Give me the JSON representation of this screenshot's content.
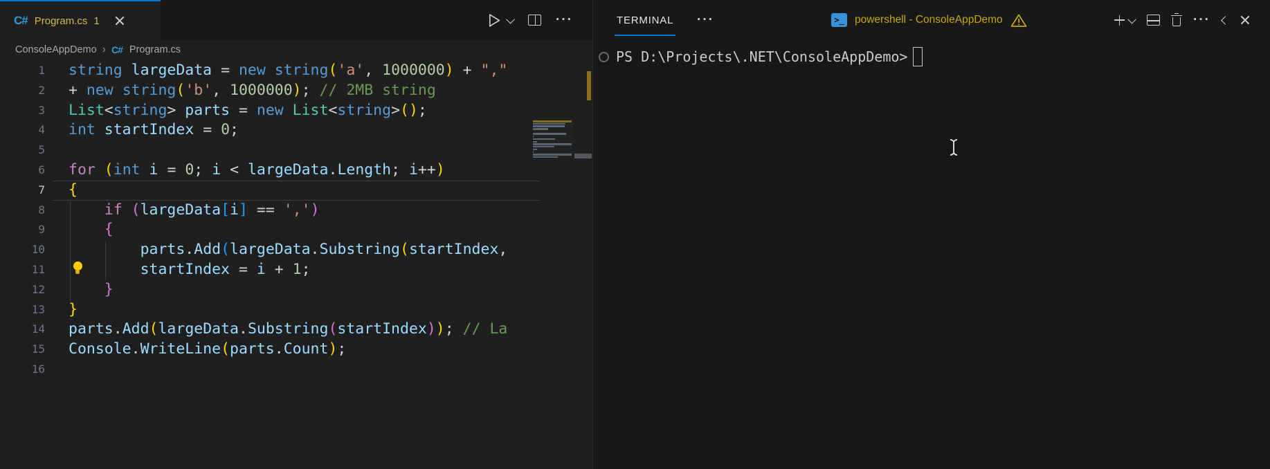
{
  "colors": {
    "accent": "#0078D4",
    "tab_modified_label": "#D7BA4D",
    "terminal_warning_label": "#CCA700",
    "editor_background": "#1F1F1F",
    "panel_background": "#181818"
  },
  "editor": {
    "tab": {
      "icon": "csharp-icon",
      "csharp_glyph": "C#",
      "label": "Program.cs",
      "badge": "1"
    },
    "actions": {
      "more_glyph": "···"
    },
    "breadcrumb": {
      "folder": "ConsoleAppDemo",
      "separator": "›",
      "csharp_glyph": "C#",
      "file": "Program.cs"
    },
    "token_colors": {
      "kw": "#569CD6",
      "ctrl": "#C586C0",
      "var": "#9CDCFE",
      "ty": "#4EC9B0",
      "num": "#B5CEA8",
      "str": "#CE9178",
      "com": "#6A9955",
      "pl": "#D4D4D4",
      "b1": "#FFD700",
      "b2": "#DA70D6",
      "b3": "#179FFF"
    },
    "lines": [
      {
        "n": "1",
        "t": [
          [
            "kw",
            "string"
          ],
          [
            "pl",
            " "
          ],
          [
            "var",
            "largeData"
          ],
          [
            "pl",
            " = "
          ],
          [
            "kw",
            "new"
          ],
          [
            "pl",
            " "
          ],
          [
            "kw",
            "string"
          ],
          [
            "b1",
            "("
          ],
          [
            "str",
            "'a'"
          ],
          [
            "pl",
            ", "
          ],
          [
            "num",
            "1000000"
          ],
          [
            "b1",
            ")"
          ],
          [
            "pl",
            " + "
          ],
          [
            "str",
            "\",\""
          ]
        ]
      },
      {
        "n": "2",
        "t": [
          [
            "pl",
            "+ "
          ],
          [
            "kw",
            "new"
          ],
          [
            "pl",
            " "
          ],
          [
            "kw",
            "string"
          ],
          [
            "b1",
            "("
          ],
          [
            "str",
            "'b'"
          ],
          [
            "pl",
            ", "
          ],
          [
            "num",
            "1000000"
          ],
          [
            "b1",
            ")"
          ],
          [
            "pl",
            "; "
          ],
          [
            "com",
            "// 2MB string"
          ]
        ]
      },
      {
        "n": "3",
        "t": [
          [
            "ty",
            "List"
          ],
          [
            "pl",
            "<"
          ],
          [
            "kw",
            "string"
          ],
          [
            "pl",
            "> "
          ],
          [
            "var",
            "parts"
          ],
          [
            "pl",
            " = "
          ],
          [
            "kw",
            "new"
          ],
          [
            "pl",
            " "
          ],
          [
            "ty",
            "List"
          ],
          [
            "pl",
            "<"
          ],
          [
            "kw",
            "string"
          ],
          [
            "pl",
            ">"
          ],
          [
            "b1",
            "()"
          ],
          [
            "pl",
            ";"
          ]
        ]
      },
      {
        "n": "4",
        "t": [
          [
            "kw",
            "int"
          ],
          [
            "pl",
            " "
          ],
          [
            "var",
            "startIndex"
          ],
          [
            "pl",
            " = "
          ],
          [
            "num",
            "0"
          ],
          [
            "pl",
            ";"
          ]
        ]
      },
      {
        "n": "5",
        "t": []
      },
      {
        "n": "6",
        "t": [
          [
            "ctrl",
            "for"
          ],
          [
            "pl",
            " "
          ],
          [
            "b1",
            "("
          ],
          [
            "kw",
            "int"
          ],
          [
            "pl",
            " "
          ],
          [
            "var",
            "i"
          ],
          [
            "pl",
            " = "
          ],
          [
            "num",
            "0"
          ],
          [
            "pl",
            "; "
          ],
          [
            "var",
            "i"
          ],
          [
            "pl",
            " < "
          ],
          [
            "var",
            "largeData"
          ],
          [
            "pl",
            "."
          ],
          [
            "var",
            "Length"
          ],
          [
            "pl",
            "; "
          ],
          [
            "var",
            "i"
          ],
          [
            "pl",
            "++"
          ],
          [
            "b1",
            ")"
          ]
        ]
      },
      {
        "n": "7",
        "current": true,
        "t": [
          [
            "b1",
            "{"
          ]
        ]
      },
      {
        "n": "8",
        "lightbulb": true,
        "t": [
          [
            "pl",
            "    "
          ],
          [
            "ctrl",
            "if"
          ],
          [
            "pl",
            " "
          ],
          [
            "b2",
            "("
          ],
          [
            "var",
            "largeData"
          ],
          [
            "b3",
            "["
          ],
          [
            "var",
            "i"
          ],
          [
            "b3",
            "]"
          ],
          [
            "pl",
            " == "
          ],
          [
            "str",
            "','"
          ],
          [
            "b2",
            ")"
          ]
        ]
      },
      {
        "n": "9",
        "t": [
          [
            "pl",
            "    "
          ],
          [
            "b2",
            "{"
          ]
        ]
      },
      {
        "n": "10",
        "t": [
          [
            "pl",
            "        "
          ],
          [
            "var",
            "parts"
          ],
          [
            "pl",
            "."
          ],
          [
            "var",
            "Add"
          ],
          [
            "b3",
            "("
          ],
          [
            "var",
            "largeData"
          ],
          [
            "pl",
            "."
          ],
          [
            "var",
            "Substring"
          ],
          [
            "b1",
            "("
          ],
          [
            "var",
            "startIndex"
          ],
          [
            "pl",
            ","
          ]
        ]
      },
      {
        "n": "11",
        "t": [
          [
            "pl",
            "        "
          ],
          [
            "var",
            "startIndex"
          ],
          [
            "pl",
            " = "
          ],
          [
            "var",
            "i"
          ],
          [
            "pl",
            " + "
          ],
          [
            "num",
            "1"
          ],
          [
            "pl",
            ";"
          ]
        ]
      },
      {
        "n": "12",
        "t": [
          [
            "pl",
            "    "
          ],
          [
            "b2",
            "}"
          ]
        ]
      },
      {
        "n": "13",
        "t": [
          [
            "b1",
            "}"
          ]
        ]
      },
      {
        "n": "14",
        "t": [
          [
            "var",
            "parts"
          ],
          [
            "pl",
            "."
          ],
          [
            "var",
            "Add"
          ],
          [
            "b1",
            "("
          ],
          [
            "var",
            "largeData"
          ],
          [
            "pl",
            "."
          ],
          [
            "var",
            "Substring"
          ],
          [
            "b2",
            "("
          ],
          [
            "var",
            "startIndex"
          ],
          [
            "b2",
            ")"
          ],
          [
            "b1",
            ")"
          ],
          [
            "pl",
            "; "
          ],
          [
            "com",
            "// La"
          ]
        ]
      },
      {
        "n": "15",
        "t": [
          [
            "var",
            "Console"
          ],
          [
            "pl",
            "."
          ],
          [
            "var",
            "WriteLine"
          ],
          [
            "b1",
            "("
          ],
          [
            "var",
            "parts"
          ],
          [
            "pl",
            "."
          ],
          [
            "var",
            "Count"
          ],
          [
            "b1",
            ")"
          ],
          [
            "pl",
            ";"
          ]
        ]
      },
      {
        "n": "16",
        "t": []
      }
    ],
    "minimap": {
      "highlight_row": 1,
      "highlight_color": "#8A6D1D",
      "bar_color": "#5A6673",
      "modified_marker_color": "#8F6F1F"
    }
  },
  "terminal": {
    "title": "TERMINAL",
    "more_glyph": "···",
    "session": {
      "icon": "powershell-icon",
      "icon_glyph": ">_",
      "label": "powershell - ConsoleAppDemo"
    },
    "prompt": "PS D:\\Projects\\.NET\\ConsoleAppDemo>"
  }
}
